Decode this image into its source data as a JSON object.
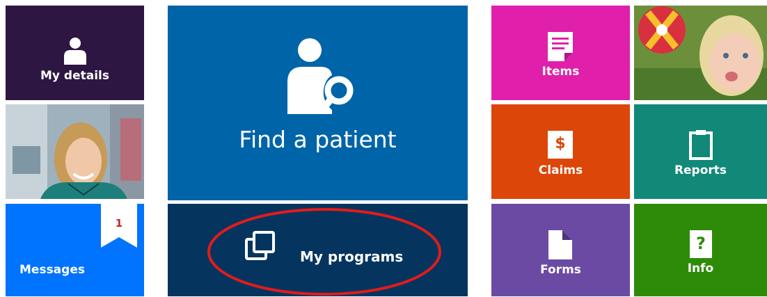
{
  "tiles": {
    "my_details": {
      "label": "My details",
      "color": "#2e1642"
    },
    "find_patient": {
      "label": "Find a patient",
      "color": "#0064a8"
    },
    "my_programs": {
      "label": "My programs",
      "color": "#05355f"
    },
    "messages": {
      "label": "Messages",
      "badge": "1",
      "color": "#0073ff"
    },
    "items": {
      "label": "Items",
      "color": "#e020aa"
    },
    "claims": {
      "label": "Claims",
      "symbol": "$",
      "color": "#dd4609"
    },
    "reports": {
      "label": "Reports",
      "color": "#118878"
    },
    "forms": {
      "label": "Forms",
      "color": "#6b4aa3"
    },
    "info": {
      "label": "Info",
      "symbol": "?",
      "color": "#2d8b08"
    }
  },
  "annotation": {
    "color": "#e31b1b"
  },
  "icons": [
    "person-icon",
    "find-patient-icon",
    "programs-icon",
    "items-icon",
    "claims-icon",
    "reports-icon",
    "forms-icon",
    "info-icon"
  ]
}
